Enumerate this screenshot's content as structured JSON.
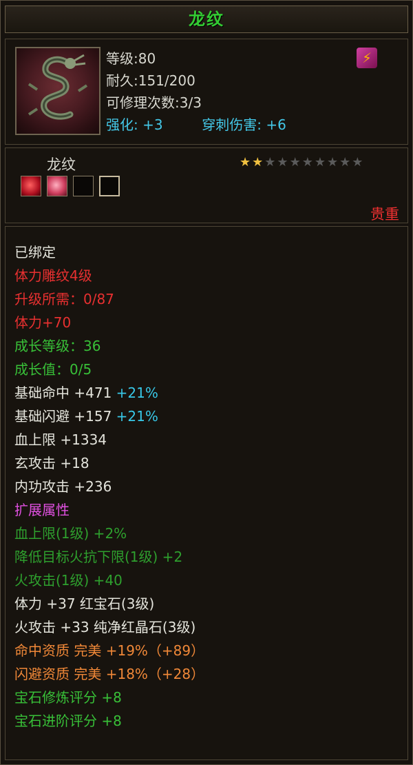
{
  "title": "龙纹",
  "header": {
    "level": "等级:80",
    "durability": "耐久:151/200",
    "repair": "可修理次数:3/3",
    "enhance": "强化: +3",
    "pierce": "穿刺伤害: +6",
    "badge_icon": "dragon-badge-icon"
  },
  "item": {
    "name": "龙纹",
    "stars_on": 2,
    "stars_total": 10,
    "rarity": "贵重"
  },
  "attributes": {
    "bound": "已绑定",
    "carve": "体力雕纹4级",
    "upgrade": "升级所需：0/87",
    "vit": "体力+70",
    "grow_level": "成长等级：36",
    "grow_value": "成长值：0/5",
    "hit": "基础命中 +471",
    "hit_pct": "+21%",
    "dodge": "基础闪避 +157",
    "dodge_pct": "+21%",
    "hp": "血上限 +1334",
    "mystic": "玄攻击 +18",
    "inner": "内功攻击 +236",
    "ext_title": "扩展属性",
    "ext1": "血上限(1级) +2%",
    "ext2": "降低目标火抗下限(1级) +2",
    "ext3": "火攻击(1级) +40",
    "gem1": "体力 +37 红宝石(3级)",
    "gem2": "火攻击 +33 纯净红晶石(3级)",
    "q1": "命中资质   完美 +19%（+89）",
    "q2": "闪避资质   完美 +18%（+28）",
    "s1": "宝石修炼评分 +8",
    "s2": "宝石进阶评分 +8"
  },
  "colors": {
    "title": "#33cc33",
    "white": "#e4e4dc",
    "red": "#e83030",
    "green": "#38c038",
    "purple": "#e050e0",
    "cyan": "#38c8e8",
    "orange": "#f08838"
  }
}
